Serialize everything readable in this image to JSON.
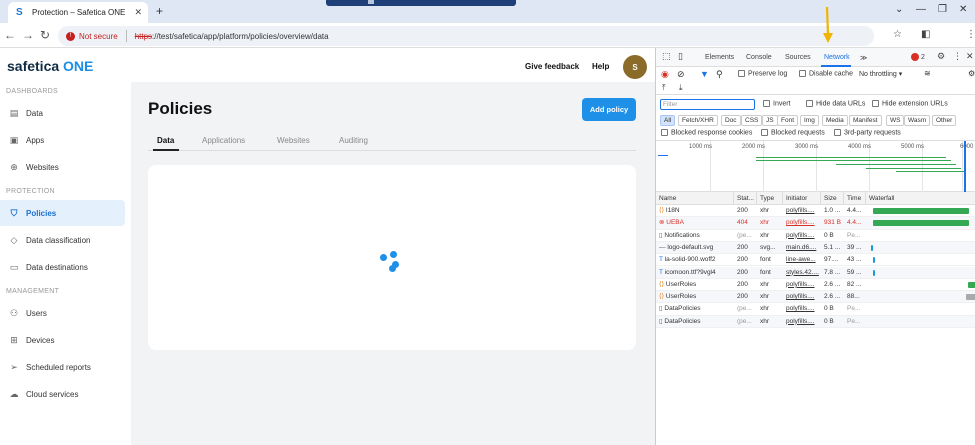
{
  "browser": {
    "tab_title": "Protection – Safetica ONE",
    "tab_icon_letter": "S",
    "new_tab": "+",
    "not_secure": "Not secure",
    "url_scheme": "https",
    "url_path": "://test/safetica/app/platform/policies/overview/data",
    "window_controls": [
      "⌄",
      "—",
      "❐",
      "✕"
    ]
  },
  "app": {
    "logo_main": "safetica",
    "logo_one": "ONE",
    "give_feedback": "Give feedback",
    "help": "Help",
    "avatar_initial": "S",
    "sections": {
      "dashboards": "DASHBOARDS",
      "protection": "PROTECTION",
      "management": "MANAGEMENT"
    },
    "nav": [
      {
        "label": "Data",
        "icon": "document-icon"
      },
      {
        "label": "Apps",
        "icon": "apps-icon"
      },
      {
        "label": "Websites",
        "icon": "globe-icon"
      },
      {
        "label": "Policies",
        "icon": "shield-icon",
        "active": true
      },
      {
        "label": "Data classification",
        "icon": "tag-icon"
      },
      {
        "label": "Data destinations",
        "icon": "destination-icon"
      },
      {
        "label": "Users",
        "icon": "users-icon"
      },
      {
        "label": "Devices",
        "icon": "devices-icon"
      },
      {
        "label": "Scheduled reports",
        "icon": "send-icon"
      },
      {
        "label": "Cloud services",
        "icon": "cloud-icon"
      }
    ],
    "page_title": "Policies",
    "add_policy": "Add policy",
    "tabs": [
      "Data",
      "Applications",
      "Websites",
      "Auditing"
    ]
  },
  "devtools": {
    "tabs": [
      "Elements",
      "Console",
      "Sources",
      "Network"
    ],
    "more": "≫",
    "error_count": "2",
    "preserve_log": "Preserve log",
    "disable_cache": "Disable cache",
    "throttling": "No throttling",
    "filter_placeholder": "Filter",
    "invert": "Invert",
    "hide_data_urls": "Hide data URLs",
    "hide_extension_urls": "Hide extension URLs",
    "type_chips": [
      "All",
      "Fetch/XHR",
      "Doc",
      "CSS",
      "JS",
      "Font",
      "Img",
      "Media",
      "Manifest",
      "WS",
      "Wasm",
      "Other"
    ],
    "blocked_cookies": "Blocked response cookies",
    "blocked_requests": "Blocked requests",
    "third_party": "3rd-party requests",
    "timeline_labels": [
      "1000 ms",
      "2000 ms",
      "3000 ms",
      "4000 ms",
      "5000 ms",
      "6000"
    ],
    "columns": [
      "Name",
      "Stat...",
      "Type",
      "Initiator",
      "Size",
      "Time",
      "Waterfall"
    ],
    "rows": [
      {
        "name": "I18N",
        "status": "200",
        "type": "xhr",
        "initiator": "polyfills....",
        "size": "1.0 ...",
        "time": "4.4...",
        "kind": "xhr"
      },
      {
        "name": "UEBA",
        "status": "404",
        "type": "xhr",
        "initiator": "polyfills....",
        "size": "931 B",
        "time": "4.4...",
        "kind": "error"
      },
      {
        "name": "Notifications",
        "status": "(pe...",
        "type": "xhr",
        "initiator": "polyfills....",
        "size": "0 B",
        "time": "Pe...",
        "kind": "doc"
      },
      {
        "name": "logo-default.svg",
        "status": "200",
        "type": "svg...",
        "initiator": "main.d6....",
        "size": "5.1 ...",
        "time": "39 ...",
        "kind": "img"
      },
      {
        "name": "la-solid-900.woff2",
        "status": "200",
        "type": "font",
        "initiator": "line-awe...",
        "size": "97....",
        "time": "43 ...",
        "kind": "font"
      },
      {
        "name": "icomoon.ttf?9vgl4",
        "status": "200",
        "type": "font",
        "initiator": "styles.42....",
        "size": "7.8 ...",
        "time": "59 ...",
        "kind": "font"
      },
      {
        "name": "UserRoles",
        "status": "200",
        "type": "xhr",
        "initiator": "polyfills....",
        "size": "2.6 ...",
        "time": "82 ...",
        "kind": "xhr"
      },
      {
        "name": "UserRoles",
        "status": "200",
        "type": "xhr",
        "initiator": "polyfills....",
        "size": "2.6 ...",
        "time": "88...",
        "kind": "xhr"
      },
      {
        "name": "DataPolicies",
        "status": "(pe...",
        "type": "xhr",
        "initiator": "polyfills....",
        "size": "0 B",
        "time": "Pe...",
        "kind": "doc"
      },
      {
        "name": "DataPolicies",
        "status": "(pe...",
        "type": "xhr",
        "initiator": "polyfills....",
        "size": "0 B",
        "time": "Pe...",
        "kind": "doc"
      }
    ]
  }
}
